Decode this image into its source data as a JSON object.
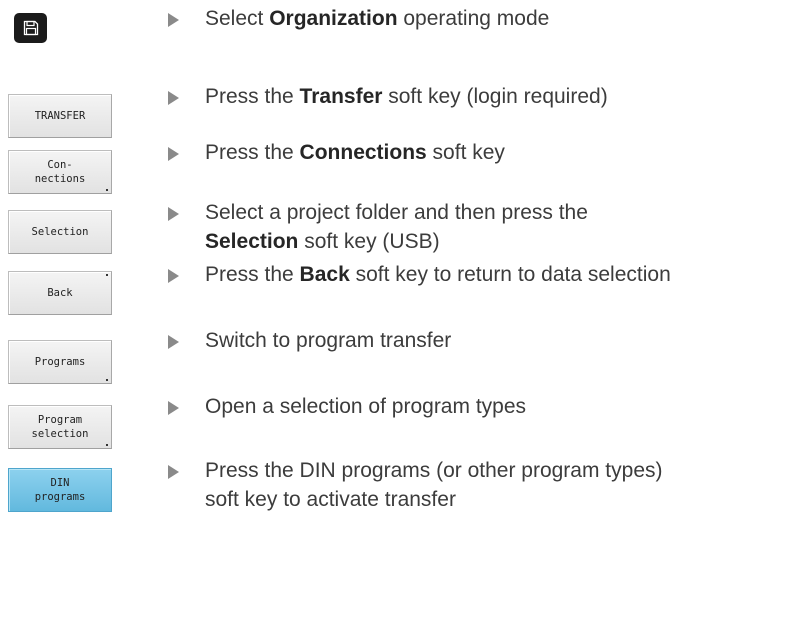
{
  "mode_button": {
    "icon": "save-disk-icon",
    "color": "#1b1b1b"
  },
  "steps": [
    {
      "parts": [
        "Select ",
        "Organization",
        " operating mode"
      ]
    },
    {
      "key": "TRANSFER",
      "parts": [
        "Press the ",
        "Transfer",
        " soft key (login required)"
      ]
    },
    {
      "key": "Con-\nnections",
      "parts": [
        "Press the ",
        "Connections",
        " soft key"
      ]
    },
    {
      "key": "Selection",
      "parts": [
        "Select a project folder and then press the",
        "Selection",
        " soft key (USB)"
      ]
    },
    {
      "key": "Back",
      "parts": [
        "Press the ",
        "Back",
        " soft key to return to data selection"
      ]
    },
    {
      "key": "Programs",
      "parts": [
        "Switch to program transfer"
      ]
    },
    {
      "key": "Program\nselection",
      "parts": [
        "Open a selection of program types"
      ]
    },
    {
      "key": "DIN\nprograms",
      "parts": [
        "Press the DIN programs (or other program types)",
        "soft key to activate transfer"
      ]
    }
  ],
  "colors": {
    "active_key": "#6cc0e5",
    "arrow": "#8a8a8a",
    "text": "#3c3c3c"
  }
}
